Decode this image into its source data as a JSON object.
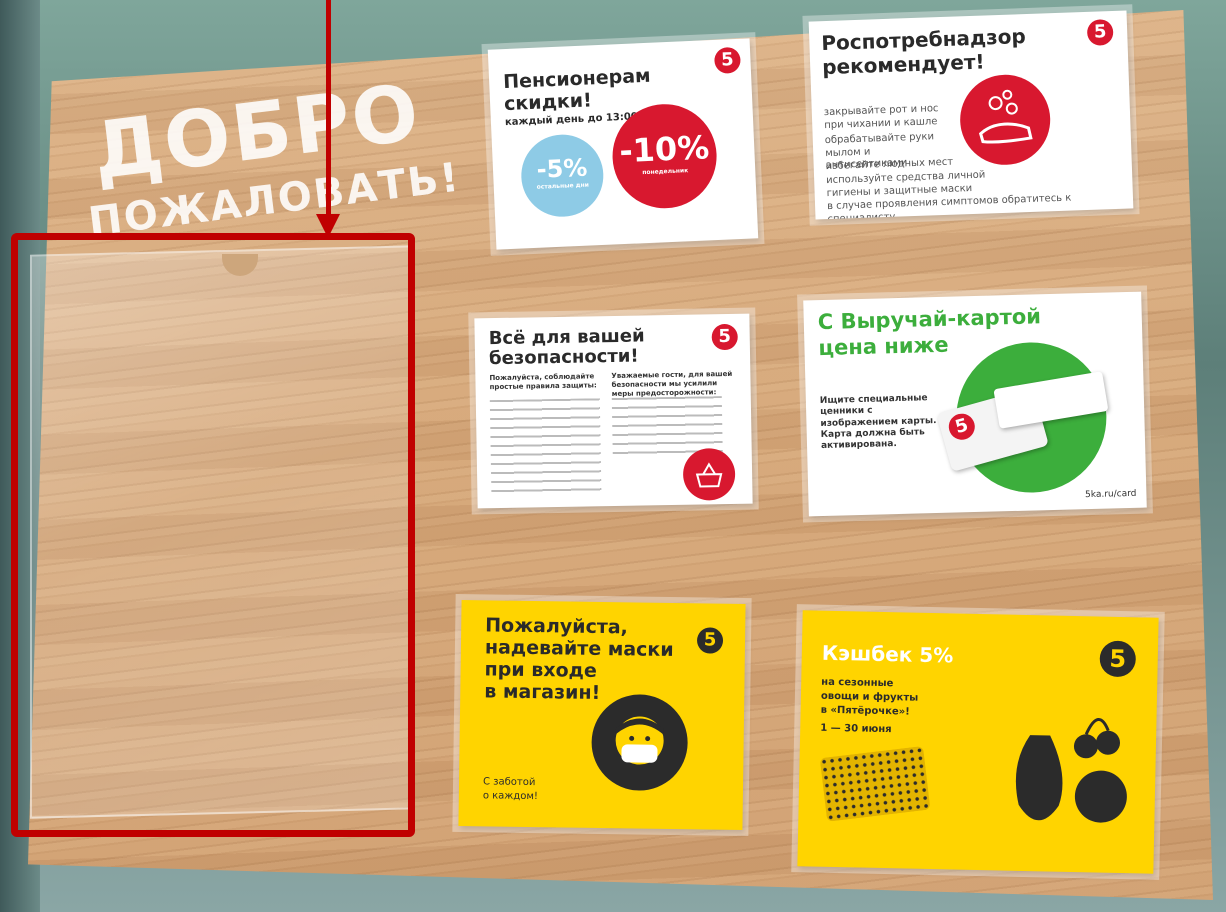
{
  "welcome": {
    "line1": "ДОБРО",
    "line2": "ПОЖАЛОВАТЬ!"
  },
  "poster_pensioners": {
    "title_line1": "Пенсионерам",
    "title_line2": "скидки!",
    "subtitle": "каждый день до 13:00",
    "discount_small": "-5%",
    "discount_small_caption": "остальные дни",
    "discount_big": "-10%",
    "discount_big_caption": "понедельник",
    "logo": "5"
  },
  "poster_rospotreb": {
    "title_line1": "Роспотребнадзор",
    "title_line2": "рекомендует!",
    "items": [
      "закрывайте рот и нос при чихании и кашле",
      "обрабатывайте руки мылом и антисептиками",
      "избегайте людных мест",
      "используйте средства личной гигиены и защитные маски",
      "в случае проявления симптомов обратитесь к специалисту"
    ],
    "logo": "5"
  },
  "poster_safety": {
    "title_line1": "Всё для вашей",
    "title_line2": "безопасности!",
    "col_left_heading": "Пожалуйста, соблюдайте простые правила защиты:",
    "col_right_heading": "Уважаемые гости, для вашей безопасности мы усилили меры предосторожности:",
    "logo": "5"
  },
  "poster_card": {
    "title_line1": "С Выручай-картой",
    "title_line2": "цена ниже",
    "body": "Ищите специальные ценники с изображением карты. Карта должна быть активирована.",
    "footer": "5ka.ru/card",
    "logo": "5"
  },
  "poster_masks": {
    "title_line1": "Пожалуйста,",
    "title_line2": "надевайте маски",
    "title_line3": "при входе",
    "title_line4": "в магазин!",
    "footer_line1": "С заботой",
    "footer_line2": "о каждом!",
    "logo": "5"
  },
  "poster_cashback": {
    "title": "Кэшбек 5%",
    "line1": "на сезонные",
    "line2": "овощи и фрукты",
    "line3": "в «Пятёрочке»!",
    "dates": "1 — 30 июня",
    "logo": "5"
  },
  "colors": {
    "annotation_red": "#c00000",
    "brand_red": "#d8182f",
    "brand_green": "#3cae3c",
    "brand_yellow": "#ffd400",
    "light_blue": "#8ecbe6"
  }
}
